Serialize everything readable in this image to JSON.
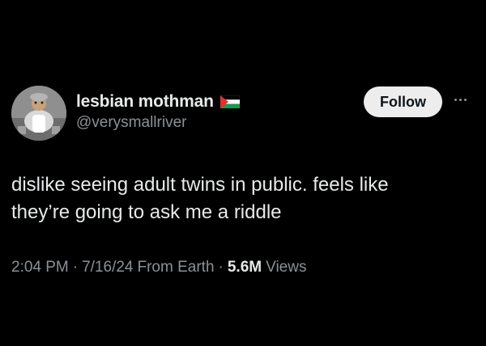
{
  "author": {
    "display_name": "lesbian mothman",
    "handle": "@verysmallriver",
    "flag_icon": "palestine-flag-icon",
    "avatar_icon": "avatar"
  },
  "actions": {
    "follow_label": "Follow",
    "more_icon": "more-icon"
  },
  "tweet": {
    "line1": "dislike seeing adult twins in public. feels like",
    "line2": "they’re going to ask me a riddle"
  },
  "meta": {
    "time": "2:04 PM",
    "date": "7/16/24",
    "source": "From Earth",
    "separator": "·",
    "views_count": "5.6M",
    "views_label": "Views"
  },
  "colors": {
    "background": "#000000",
    "primary_text": "#e7e9ea",
    "secondary_text": "#8b9196",
    "follow_bg": "#ededed",
    "follow_text": "#0f1419"
  }
}
